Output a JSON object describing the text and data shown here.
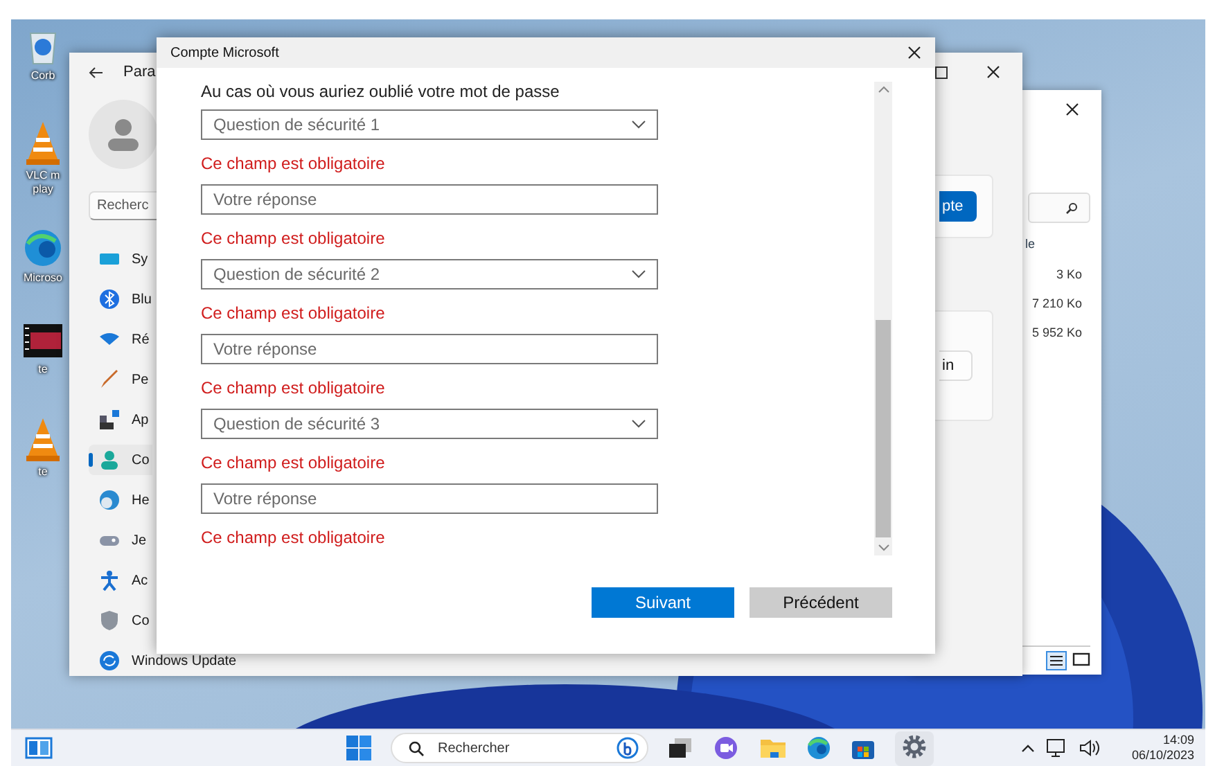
{
  "desktop_icons": [
    {
      "label": "Corb"
    },
    {
      "label": "VLC m play"
    },
    {
      "label": "Microso"
    },
    {
      "label": "te"
    },
    {
      "label": "te"
    }
  ],
  "settings": {
    "title": "Para",
    "search": {
      "placeholder": "Recherc"
    },
    "nav": [
      {
        "label": "Sy",
        "selected": false
      },
      {
        "label": "Blu",
        "selected": false
      },
      {
        "label": "Ré",
        "selected": false
      },
      {
        "label": "Pe",
        "selected": false
      },
      {
        "label": "Ap",
        "selected": false
      },
      {
        "label": "Co",
        "selected": true
      },
      {
        "label": "He",
        "selected": false
      },
      {
        "label": "Je",
        "selected": false
      },
      {
        "label": "Ac",
        "selected": false
      },
      {
        "label": "Co",
        "selected": false
      },
      {
        "label": "Windows Update",
        "selected": false
      }
    ],
    "account_button": "pte",
    "sign_in_button": "in"
  },
  "explorer": {
    "column_header": "le",
    "sizes": [
      "3 Ko",
      "7 210 Ko",
      "5 952 Ko"
    ]
  },
  "dialog": {
    "title": "Compte Microsoft",
    "intro": "Au cas où vous auriez oublié votre mot de passe",
    "fields": [
      {
        "kind": "select",
        "placeholder": "Question de sécurité 1",
        "error": "Ce champ est obligatoire"
      },
      {
        "kind": "text",
        "placeholder": "Votre réponse",
        "error": "Ce champ est obligatoire"
      },
      {
        "kind": "select",
        "placeholder": "Question de sécurité 2",
        "error": "Ce champ est obligatoire"
      },
      {
        "kind": "text",
        "placeholder": "Votre réponse",
        "error": "Ce champ est obligatoire"
      },
      {
        "kind": "select",
        "placeholder": "Question de sécurité 3",
        "error": "Ce champ est obligatoire"
      },
      {
        "kind": "text",
        "placeholder": "Votre réponse",
        "error": "Ce champ est obligatoire"
      }
    ],
    "buttons": [
      {
        "label": "Suivant",
        "kind": "primary"
      },
      {
        "label": "Précédent",
        "kind": "secondary"
      }
    ]
  },
  "taskbar": {
    "search": {
      "placeholder": "Rechercher"
    },
    "time": "14:09",
    "date": "06/10/2023"
  }
}
